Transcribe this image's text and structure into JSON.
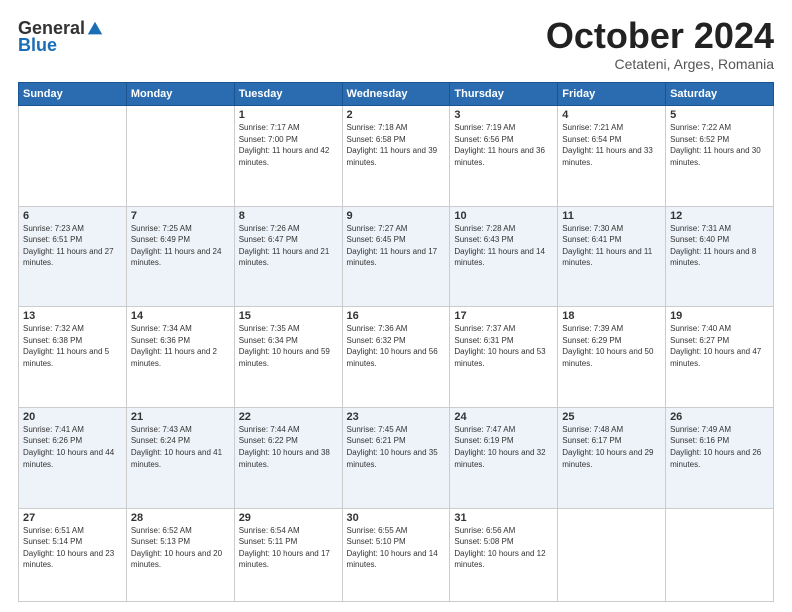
{
  "header": {
    "logo_general": "General",
    "logo_blue": "Blue",
    "month": "October 2024",
    "location": "Cetateni, Arges, Romania"
  },
  "days_of_week": [
    "Sunday",
    "Monday",
    "Tuesday",
    "Wednesday",
    "Thursday",
    "Friday",
    "Saturday"
  ],
  "weeks": [
    [
      {
        "num": "",
        "info": ""
      },
      {
        "num": "",
        "info": ""
      },
      {
        "num": "1",
        "info": "Sunrise: 7:17 AM\nSunset: 7:00 PM\nDaylight: 11 hours and 42 minutes."
      },
      {
        "num": "2",
        "info": "Sunrise: 7:18 AM\nSunset: 6:58 PM\nDaylight: 11 hours and 39 minutes."
      },
      {
        "num": "3",
        "info": "Sunrise: 7:19 AM\nSunset: 6:56 PM\nDaylight: 11 hours and 36 minutes."
      },
      {
        "num": "4",
        "info": "Sunrise: 7:21 AM\nSunset: 6:54 PM\nDaylight: 11 hours and 33 minutes."
      },
      {
        "num": "5",
        "info": "Sunrise: 7:22 AM\nSunset: 6:52 PM\nDaylight: 11 hours and 30 minutes."
      }
    ],
    [
      {
        "num": "6",
        "info": "Sunrise: 7:23 AM\nSunset: 6:51 PM\nDaylight: 11 hours and 27 minutes."
      },
      {
        "num": "7",
        "info": "Sunrise: 7:25 AM\nSunset: 6:49 PM\nDaylight: 11 hours and 24 minutes."
      },
      {
        "num": "8",
        "info": "Sunrise: 7:26 AM\nSunset: 6:47 PM\nDaylight: 11 hours and 21 minutes."
      },
      {
        "num": "9",
        "info": "Sunrise: 7:27 AM\nSunset: 6:45 PM\nDaylight: 11 hours and 17 minutes."
      },
      {
        "num": "10",
        "info": "Sunrise: 7:28 AM\nSunset: 6:43 PM\nDaylight: 11 hours and 14 minutes."
      },
      {
        "num": "11",
        "info": "Sunrise: 7:30 AM\nSunset: 6:41 PM\nDaylight: 11 hours and 11 minutes."
      },
      {
        "num": "12",
        "info": "Sunrise: 7:31 AM\nSunset: 6:40 PM\nDaylight: 11 hours and 8 minutes."
      }
    ],
    [
      {
        "num": "13",
        "info": "Sunrise: 7:32 AM\nSunset: 6:38 PM\nDaylight: 11 hours and 5 minutes."
      },
      {
        "num": "14",
        "info": "Sunrise: 7:34 AM\nSunset: 6:36 PM\nDaylight: 11 hours and 2 minutes."
      },
      {
        "num": "15",
        "info": "Sunrise: 7:35 AM\nSunset: 6:34 PM\nDaylight: 10 hours and 59 minutes."
      },
      {
        "num": "16",
        "info": "Sunrise: 7:36 AM\nSunset: 6:32 PM\nDaylight: 10 hours and 56 minutes."
      },
      {
        "num": "17",
        "info": "Sunrise: 7:37 AM\nSunset: 6:31 PM\nDaylight: 10 hours and 53 minutes."
      },
      {
        "num": "18",
        "info": "Sunrise: 7:39 AM\nSunset: 6:29 PM\nDaylight: 10 hours and 50 minutes."
      },
      {
        "num": "19",
        "info": "Sunrise: 7:40 AM\nSunset: 6:27 PM\nDaylight: 10 hours and 47 minutes."
      }
    ],
    [
      {
        "num": "20",
        "info": "Sunrise: 7:41 AM\nSunset: 6:26 PM\nDaylight: 10 hours and 44 minutes."
      },
      {
        "num": "21",
        "info": "Sunrise: 7:43 AM\nSunset: 6:24 PM\nDaylight: 10 hours and 41 minutes."
      },
      {
        "num": "22",
        "info": "Sunrise: 7:44 AM\nSunset: 6:22 PM\nDaylight: 10 hours and 38 minutes."
      },
      {
        "num": "23",
        "info": "Sunrise: 7:45 AM\nSunset: 6:21 PM\nDaylight: 10 hours and 35 minutes."
      },
      {
        "num": "24",
        "info": "Sunrise: 7:47 AM\nSunset: 6:19 PM\nDaylight: 10 hours and 32 minutes."
      },
      {
        "num": "25",
        "info": "Sunrise: 7:48 AM\nSunset: 6:17 PM\nDaylight: 10 hours and 29 minutes."
      },
      {
        "num": "26",
        "info": "Sunrise: 7:49 AM\nSunset: 6:16 PM\nDaylight: 10 hours and 26 minutes."
      }
    ],
    [
      {
        "num": "27",
        "info": "Sunrise: 6:51 AM\nSunset: 5:14 PM\nDaylight: 10 hours and 23 minutes."
      },
      {
        "num": "28",
        "info": "Sunrise: 6:52 AM\nSunset: 5:13 PM\nDaylight: 10 hours and 20 minutes."
      },
      {
        "num": "29",
        "info": "Sunrise: 6:54 AM\nSunset: 5:11 PM\nDaylight: 10 hours and 17 minutes."
      },
      {
        "num": "30",
        "info": "Sunrise: 6:55 AM\nSunset: 5:10 PM\nDaylight: 10 hours and 14 minutes."
      },
      {
        "num": "31",
        "info": "Sunrise: 6:56 AM\nSunset: 5:08 PM\nDaylight: 10 hours and 12 minutes."
      },
      {
        "num": "",
        "info": ""
      },
      {
        "num": "",
        "info": ""
      }
    ]
  ]
}
